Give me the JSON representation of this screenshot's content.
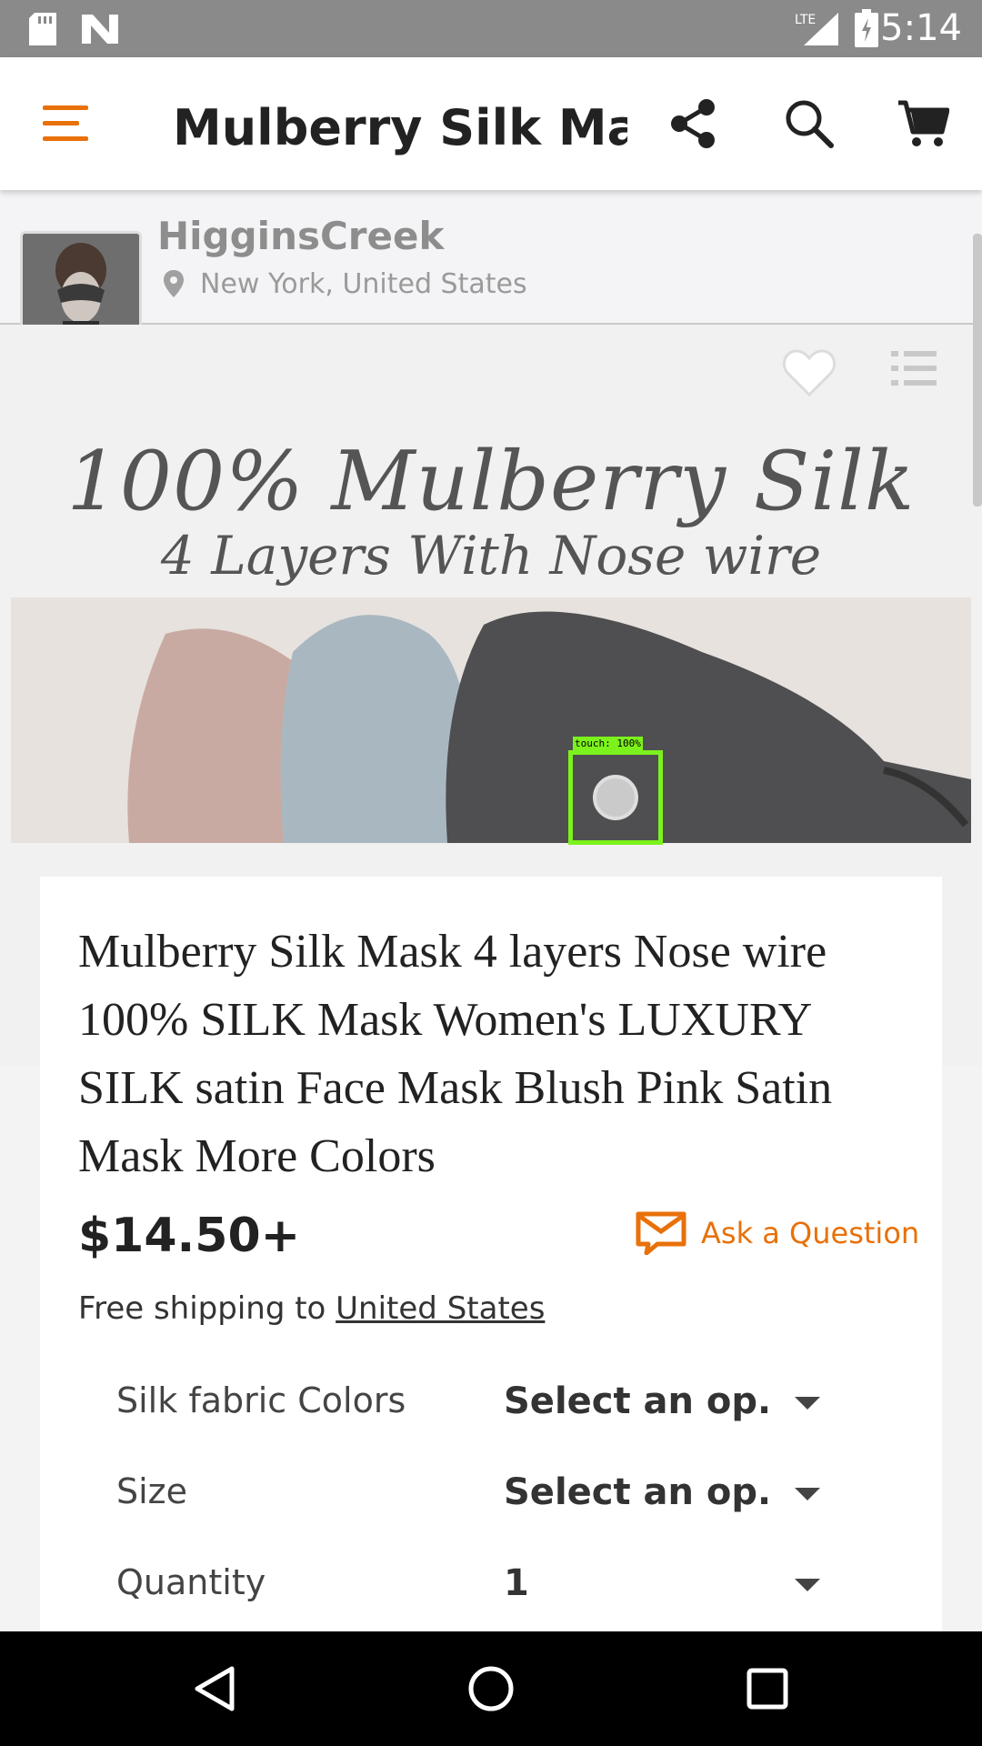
{
  "status_bar": {
    "time": "5:14",
    "network": "LTE"
  },
  "app_bar": {
    "title": "Mulberry Silk Mas...",
    "icons": [
      "menu-icon",
      "share-icon",
      "search-icon",
      "cart-icon"
    ]
  },
  "shop": {
    "name": "HigginsCreek",
    "location": "New York, United States"
  },
  "hero": {
    "headline": "100% Mulberry Silk",
    "subheadline": "4 Layers With Nose wire"
  },
  "touch_overlay": {
    "label": "touch: 100%"
  },
  "product": {
    "title": "Mulberry Silk Mask 4 layers Nose wire 100% SILK Mask Women's LUXURY SILK satin Face Mask Blush Pink Satin Mask More Colors",
    "price": "$14.50+",
    "ask_label": "Ask a Question",
    "shipping_prefix": "Free shipping to",
    "shipping_link": "United States",
    "options": [
      {
        "label": "Silk fabric Colors",
        "value": "Select an op.."
      },
      {
        "label": "Size",
        "value": "Select an op.."
      },
      {
        "label": "Quantity",
        "value": "1"
      }
    ]
  },
  "colors": {
    "accent": "#e8710a",
    "touch_box": "#7cf21c"
  }
}
